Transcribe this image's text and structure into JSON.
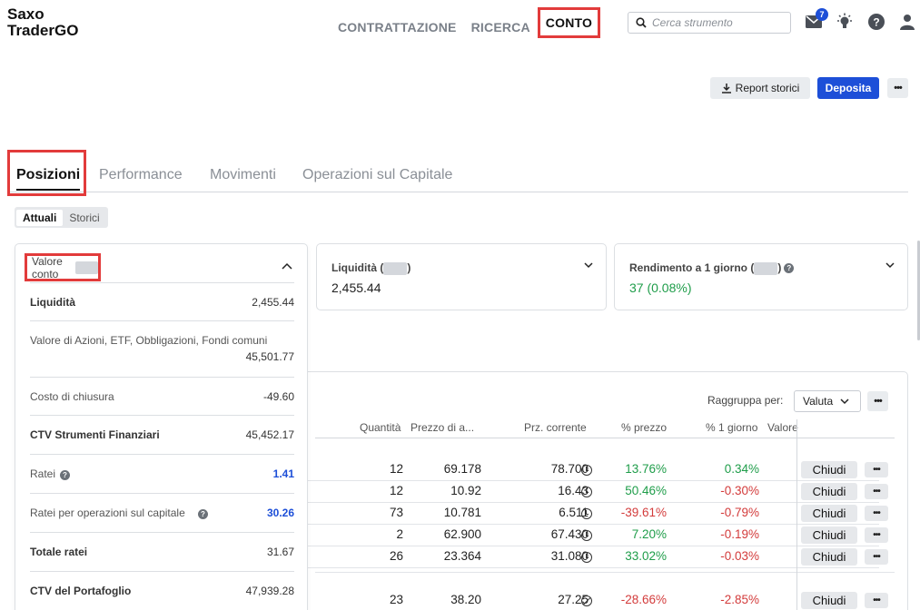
{
  "app": {
    "logo_line1": "Saxo",
    "logo_line2": "TraderGO"
  },
  "nav": {
    "items": [
      "CONTRATTAZIONE",
      "RICERCA",
      "CONTO"
    ]
  },
  "search": {
    "placeholder": "Cerca strumento"
  },
  "header": {
    "mail_badge": "7"
  },
  "actions": {
    "report": "Report storici",
    "deposit": "Deposita"
  },
  "tabs": [
    "Posizioni",
    "Performance",
    "Movimenti",
    "Operazioni sul Capitale"
  ],
  "segment": [
    "Attuali",
    "Storici"
  ],
  "summary": {
    "account_value_title": "Valore conto",
    "liquidity_title": "Liquidità (",
    "liquidity_title_end": ")",
    "liquidity_value": "2,455.44",
    "return_title": "Rendimento a 1 giorno (",
    "return_title_end": ")",
    "return_value": "37 (0.08%)"
  },
  "breakdown": [
    {
      "label": "Liquidità",
      "value": "2,455.44",
      "bold": true
    },
    {
      "label": "Valore di Azioni, ETF, Obbligazioni, Fondi comuni",
      "value": "45,501.77"
    },
    {
      "label": "Costo di chiusura",
      "value": "-49.60"
    },
    {
      "label": "CTV Strumenti Finanziari",
      "value": "45,452.17",
      "bold": true
    },
    {
      "label": "Ratei",
      "value": "1.41"
    },
    {
      "label": "Ratei per operazioni sul capitale",
      "value": "30.26"
    },
    {
      "label": "Totale ratei",
      "value": "31.67",
      "bold": true
    },
    {
      "label": "CTV del Portafoglio",
      "value": "47,939.28",
      "bold": true
    }
  ],
  "table": {
    "group_by_label": "Raggruppa per:",
    "group_by_value": "Valuta",
    "columns": [
      "Quantità",
      "Prezzo di a...",
      "Prz. corrente",
      "% prezzo",
      "% 1 giorno",
      "Valore"
    ],
    "close_label": "Chiudi",
    "rows": [
      {
        "qty": "12",
        "buy": "69.178",
        "cur": "78.700",
        "pct": "13.76%",
        "day": "0.34%"
      },
      {
        "qty": "12",
        "buy": "10.92",
        "cur": "16.43",
        "pct": "50.46%",
        "day": "-0.30%"
      },
      {
        "qty": "73",
        "buy": "10.781",
        "cur": "6.511",
        "pct": "-39.61%",
        "day": "-0.79%"
      },
      {
        "qty": "2",
        "buy": "62.900",
        "cur": "67.430",
        "pct": "7.20%",
        "day": "-0.19%"
      },
      {
        "qty": "26",
        "buy": "23.364",
        "cur": "31.080",
        "pct": "33.02%",
        "day": "-0.03%"
      },
      {
        "qty": "23",
        "buy": "38.20",
        "cur": "27.25",
        "pct": "-28.66%",
        "day": "-2.85%"
      }
    ]
  },
  "colors": {
    "accent": "#1d4fd8",
    "positive": "#1f9d4a",
    "negative": "#d33b3b",
    "highlight": "#e23b3b"
  }
}
